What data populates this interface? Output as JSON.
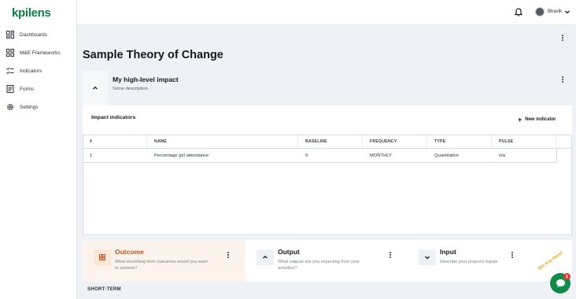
{
  "brand": {
    "logo_text": "kpilens",
    "accent": "#18a05c"
  },
  "sidebar": {
    "items": [
      {
        "label": "Dashboards",
        "icon": "dashboard-icon"
      },
      {
        "label": "M&E Frameworks",
        "icon": "frameworks-icon"
      },
      {
        "label": "Indicators",
        "icon": "indicators-icon"
      },
      {
        "label": "Forms",
        "icon": "forms-icon"
      },
      {
        "label": "Settings",
        "icon": "gear-icon"
      }
    ]
  },
  "topbar": {
    "user_name": "Bhavik"
  },
  "page": {
    "title": "Sample Theory of Change"
  },
  "impact": {
    "title": "My high-level impact",
    "description": "Some description",
    "indicators_label": "Impact indicators",
    "new_indicator_label": "New indicator",
    "table": {
      "columns": [
        "#",
        "NAME",
        "BASELINE",
        "FREQUENCY",
        "TYPE",
        "PULSE"
      ],
      "rows": [
        {
          "num": "1",
          "name": "Percentage girl attendance",
          "baseline": "0",
          "frequency": "MONTHLY",
          "type": "Quantitative",
          "pulse": "n/a"
        }
      ]
    }
  },
  "cards": {
    "outcome": {
      "title": "Outcome",
      "desc_line1": "What short/long term outcomes would you want",
      "desc_line2": "to achieve?",
      "color": "#b5541f"
    },
    "output": {
      "title": "Output",
      "desc_line1": "What outputs are you expecting from your",
      "desc_line2": "activities?"
    },
    "input": {
      "title": "Input",
      "desc_line1": "Describe your project's inputs",
      "desc_line2": ""
    }
  },
  "section": {
    "short_term_label": "SHORT-TERM"
  },
  "chat": {
    "badge_text": "We Are Here!",
    "unread_count": "1"
  }
}
